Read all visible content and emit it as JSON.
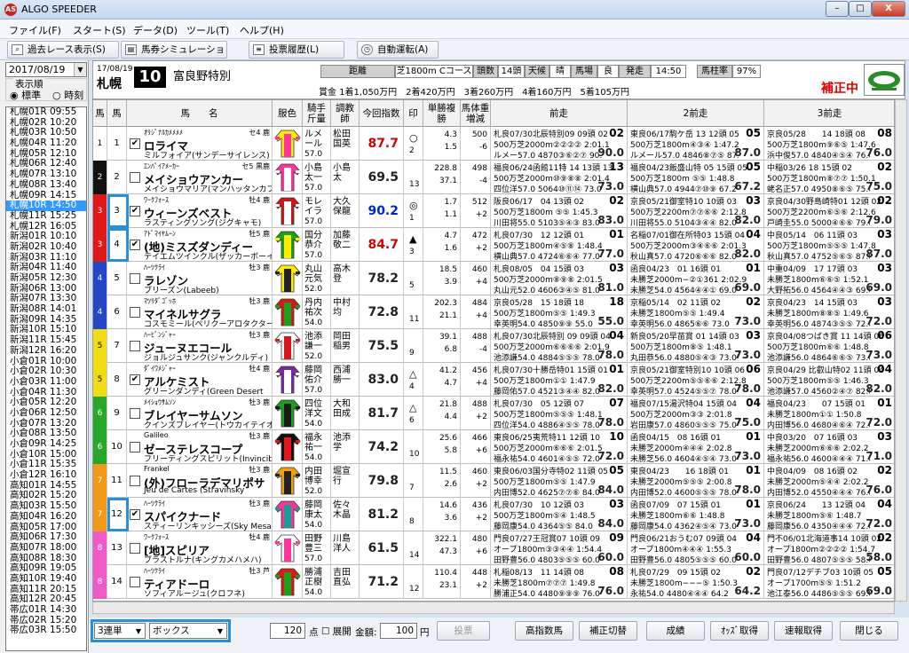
{
  "window": {
    "title": "ALGO SPEEDER",
    "app_icon": "AS",
    "min": "–",
    "max": "□",
    "close": "X"
  },
  "menu": [
    "ファイル(F)",
    "スタート(S)",
    "データ(D)",
    "ツール(T)",
    "ヘルプ(H)"
  ],
  "toolbar": {
    "past": "過去レース表示(S)",
    "sim": "馬券シミュレーション(B)",
    "history": "投票履歴(L)",
    "auto": "自動運転(A)"
  },
  "left": {
    "date": "2017/08/19",
    "group_label": "表示順",
    "radio_std": "標準",
    "radio_time": "時刻",
    "races": [
      "札幌01R 09:55",
      "札幌02R 10:20",
      "札幌03R 10:50",
      "札幌04R 11:20",
      "札幌05R 12:10",
      "札幌06R 12:40",
      "札幌07R 13:10",
      "札幌08R 13:40",
      "札幌09R 14:15",
      "札幌10R 14:50",
      "札幌11R 15:25",
      "札幌12R 16:05",
      "新潟01R 10:10",
      "新潟02R 10:40",
      "新潟03R 11:10",
      "新潟04R 11:40",
      "新潟05R 12:30",
      "新潟06R 13:00",
      "新潟07R 13:30",
      "新潟08R 14:01",
      "新潟09R 14:35",
      "新潟10R 15:10",
      "新潟11R 15:45",
      "新潟12R 16:20",
      "小倉01R 10:00",
      "小倉02R 10:30",
      "小倉03R 11:00",
      "小倉04R 11:30",
      "小倉05R 12:20",
      "小倉06R 12:50",
      "小倉07R 13:20",
      "小倉08R 13:50",
      "小倉09R 14:25",
      "小倉10R 15:00",
      "小倉11R 15:35",
      "小倉12R 16:10",
      "高知01R 14:55",
      "高知02R 15:20",
      "高知03R 15:50",
      "高知04R 16:20",
      "高知05R 17:00",
      "高知06R 17:30",
      "高知07R 18:00",
      "高知08R 18:30",
      "高知09R 19:05",
      "高知10R 19:40",
      "高知11R 20:15",
      "高知12R 20:45",
      "帯広01R 14:30",
      "帯広02R 15:20",
      "帯広03R 15:50"
    ],
    "selected_index": 9
  },
  "header": {
    "date": "17/08/19",
    "place": "札幌",
    "race_no": "10",
    "race_name": "富良野特別",
    "dist_label": "距離",
    "dist": "芝1800m Cコース",
    "heads_label": "頭数",
    "heads": "14頭",
    "weather_label": "天候",
    "weather": "晴",
    "baba_label": "馬場",
    "baba": "良",
    "start_label": "発走",
    "start": "14:50",
    "rate_label": "馬柱率",
    "rate": "97%",
    "prize": "賞金 1着1,050万円　2着420万円　3着260万円　4着160万円　5着105万円",
    "status": "補正中"
  },
  "columns": [
    "馬",
    "馬",
    "馬　　名",
    "服色",
    "騎手斤量",
    "調教師",
    "今回指数",
    "印",
    "単勝複勝",
    "馬体重増減",
    "前走",
    "2前走",
    "3前走"
  ],
  "horses": [
    {
      "waku": "1",
      "no": "1",
      "checked": true,
      "sire": "ｵﾘｼﾞﾅﾙｶﾒﾒﾒﾒ",
      "sexage": "セ4 鹿",
      "name": "ロライマ",
      "dam": "ミルフォイア(サンデーサイレンス)",
      "jockey": "ルメール",
      "weight": "57.0",
      "trainer": "松田国英",
      "score": "87.7",
      "mark": "○",
      "mark2": "2",
      "win": "4.3",
      "place": "1.5",
      "bw": "500",
      "bwd": "-6",
      "p1a": "札良07/30北辰特別09 09頭 02",
      "p1b": "500万芝2000m②②②② 2:01.1",
      "p1c": "ルメー57.0 4870③⑥②⑦ 90.0",
      "p1r": "02",
      "p1i": "90.0",
      "p2a": "東良06/17駒ケ岳 13 12頭 05",
      "p2b": "500万芝1800m④③④ 1:47.2",
      "p2c": "ルメール57.0 4846⑧⑦⑤ 87.0",
      "p2r": "05",
      "p2i": "87.0",
      "p3a": "京良05/28　　14 18頭 08",
      "p3b": "500万芝1800m⑨⑥⑤ 1:47.6",
      "p3c": "浜中俊57.0 4840④⑤④ 76.0",
      "p3r": "08",
      "p3i": "76.0"
    },
    {
      "waku": "2",
      "no": "2",
      "checked": false,
      "sire": "ｴﾝﾊﾟｲｱﾒｰｶｰ",
      "sexage": "セ5 黒鹿",
      "name": "メイショウアンカー",
      "dam": "メイショウマリア(マンハッタンカフェ)",
      "jockey": "小島太一",
      "weight": "57.0",
      "trainer": "小島太",
      "score": "69.5",
      "mark": "",
      "mark2": "13",
      "win": "228.8",
      "place": "37.1",
      "bw": "498",
      "bwd": "-4",
      "p1a": "福良06/24函館11特 14 13頭 13",
      "p1b": "500万芝2000m⑩⑨⑧⑧ 2:01.4",
      "p1c": "四位洋57.0 5064⑩⑪⑭ 73.0",
      "p1r": "13",
      "p1i": "73.0",
      "p2a": "福良04/23飯盛山特 05 15頭 05",
      "p2b": "500万芝1800m ⑤⑤ 1:48.8",
      "p2c": "横山典57.0 4944⑦⑩⑨ 67.2",
      "p2r": "05",
      "p2i": "67.2",
      "p3a": "中稲03/26 18 15頭 02",
      "p3b": "500万芝1800m⑧⑦⑦ 1:50.1",
      "p3c": "蛯名正57.0 4950⑧⑥⑤ 75.0",
      "p3r": "02",
      "p3i": "75.0"
    },
    {
      "waku": "3",
      "no": "3",
      "checked": true,
      "sire": "ﾜｰｸﾌｫｰｽ",
      "sexage": "牡4 鹿",
      "name": "ウィーンズベスト",
      "dam": "ラスティングソング(ジグキャモ)",
      "jockey": "モレイラ",
      "weight": "57.0",
      "trainer": "大久保龍",
      "score": "90.2",
      "mark": "◎",
      "mark2": "1",
      "win": "1.7",
      "place": "1.1",
      "bw": "512",
      "bwd": "+2",
      "p1a": "阪良06/17　04 13頭 02",
      "p1b": "500万芝1800m ⑤⑤ 1:45.3",
      "p1c": "川田将55.0 5103⑤④③ 83.0",
      "p1r": "02",
      "p1i": "83.0",
      "p2a": "京良05/21御室特10 10頭 03",
      "p2b": "500万芝2200m⑦⑦⑥⑥ 2:12.8",
      "p2c": "川田将55.0 5104③④④ 82.0",
      "p2r": "03",
      "p2i": "82.0",
      "p3a": "京良04/30野島崎特01 12頭 02",
      "p3b": "500万芝2200m⑥⑤⑥ 2:12.6",
      "p3c": "戸崎圭55.0 5000④⑥⑥ 79.0",
      "p3r": "02",
      "p3i": "79.0"
    },
    {
      "waku": "3",
      "no": "4",
      "checked": true,
      "sire": "ｱﾄﾞﾏｲﾔﾑｰﾝ",
      "sexage": "牡5 鹿",
      "name": "(地)ミスズダンディー",
      "dam": "テイエムツインクル(ザッカーボーイ)",
      "jockey": "国分恭介",
      "weight": "57.0",
      "trainer": "加藤敬二",
      "score": "84.7",
      "mark": "▲",
      "mark2": "3",
      "win": "4.7",
      "place": "1.6",
      "bw": "472",
      "bwd": "+2",
      "p1a": "札良07/30　12 12頭 01",
      "p1b": "500万芝1800m④⑤⑧ 1:48.4",
      "p1c": "横山典57.0 4724⑥⑥④ 77.0",
      "p1r": "01",
      "p1i": "77.0",
      "p2a": "名稲07/01御在所特03 15頭 04",
      "p2b": "500万芝2000m③④⑥⑥ 2:01.3",
      "p2c": "秋山真57.0 4720⑥⑥⑥ 82.0",
      "p2r": "04",
      "p2i": "82.0",
      "p3a": "中良05/14　06 11頭 03",
      "p3b": "500万芝1800m⑤⑤⑤ 1:47.8",
      "p3c": "秋山真57.0 4752⑤⑥⑤ 87.0",
      "p3r": "03",
      "p3i": "87.0"
    },
    {
      "waku": "4",
      "no": "5",
      "checked": false,
      "sire": "ﾊｰﾂｸﾗｲ",
      "sexage": "牡3 鹿",
      "name": "ラレゾン",
      "dam": "ブリーズン(Labeeb)",
      "jockey": "丸山元気",
      "weight": "52.0",
      "trainer": "高木登",
      "score": "78.2",
      "mark": "",
      "mark2": "5",
      "win": "18.5",
      "place": "3.9",
      "bw": "460",
      "bwd": "+4",
      "p1a": "札良08/05　04 15頭 03",
      "p1b": "500万芝2000m⑧⑨⑧ 2:01.5",
      "p1c": "丸山元52.0 4606③④⑤ 81.0",
      "p1r": "03",
      "p1i": "81.0",
      "p2a": "函良04/23　01 16頭 01",
      "p2b": "未勝芝2000m−②①361 2:02.9",
      "p2c": "未勝芝54.0 4564④④① 69.0",
      "p2r": "01",
      "p2i": "69.0",
      "p3a": "中重04/09　17 17頭 03",
      "p3b": "未勝芝1800m⑥⑥⑤ 1:52.1",
      "p3c": "大野拓56.0 4564④④③ 69.0",
      "p3r": "03",
      "p3i": "69.0"
    },
    {
      "waku": "4",
      "no": "6",
      "checked": false,
      "sire": "ﾏﾂﾘﾀﾞｺﾞｯﾎ",
      "sexage": "牡3 鹿",
      "name": "マイネルサグラ",
      "dam": "コスモミール(ペリクーアロタクター)",
      "jockey": "丹内祐次",
      "weight": "54.0",
      "trainer": "中村均",
      "score": "72.8",
      "mark": "",
      "mark2": "11",
      "win": "202.3",
      "place": "21.1",
      "bw": "484",
      "bwd": "+4",
      "p1a": "京良05/28　15 18頭 18",
      "p1b": "500万芝1800m⑤⑤ 1:49.3",
      "p1c": "幸英明54.0 4850⑨⑨ 55.0",
      "p1r": "18",
      "p1i": "55.0",
      "p2a": "京稲05/14　02 11頭 02",
      "p2b": "未勝芝1800m⑤⑤ 1:49.4",
      "p2c": "幸英明56.0 4865⑥⑥ 73.0",
      "p2r": "02",
      "p2i": "73.0",
      "p3a": "京良04/23　14 15頭 03",
      "p3b": "未勝芝1800m⑧⑧⑤ 1:49.6",
      "p3c": "幸英明56.0 4874③⑤⑤ 72.0",
      "p3r": "03",
      "p3i": "72.0"
    },
    {
      "waku": "5",
      "no": "7",
      "checked": false,
      "sire": "ﾊｰﾋﾞﾝｼﾞｬｰ",
      "sexage": "牡3 鹿",
      "name": "ジューヌエコール",
      "dam": "ジョルジュサンク(ジャンクルディ)",
      "jockey": "池添謙一",
      "weight": "52.0",
      "trainer": "岡田稲男",
      "score": "75.5",
      "mark": "",
      "mark2": "9",
      "win": "39.1",
      "place": "6.8",
      "bw": "488",
      "bwd": "-4",
      "p1a": "札良07/30北辰特別 09 09頭 04",
      "p1b": "500万芝2000m⑥⑥⑥⑥ 2:01.9",
      "p1c": "池添謙54.0 4884⑤⑤⑤ 78.0",
      "p1r": "04",
      "p1i": "78.0",
      "p2a": "新良05/20早苗賞 01 14頭 03",
      "p2b": "500万芝1800m⑧⑤ 1:48.1",
      "p2c": "丸田恭56.0 4880⑤④③ 73.0",
      "p2r": "03",
      "p2i": "73.0",
      "p3a": "京良04/08つばき賞 11 14頭 06",
      "p3b": "500万芝1800m⑥⑥ 1:48.8",
      "p3c": "池添謙56.0 4864⑥⑥⑤ 73.0",
      "p3r": "06",
      "p3i": "73.0"
    },
    {
      "waku": "5",
      "no": "8",
      "checked": true,
      "sire": "ﾀﾞｲﾜﾒｼﾞｬｰ",
      "sexage": "牡4 鹿",
      "name": "アルケミスト",
      "dam": "グリーンダンディ(Green Desert",
      "jockey": "藤岡佑介",
      "weight": "57.0",
      "trainer": "西浦勝一",
      "score": "83.0",
      "mark": "△",
      "mark2": "4",
      "win": "41.2",
      "place": "4.7",
      "bw": "456",
      "bwd": "+4",
      "p1a": "札良07/30十勝岳特01 15頭 01",
      "p1b": "500万芝1800m①① 1:47.9",
      "p1c": "藤岡佑57.0 4521③④④ 82.0",
      "p1r": "01",
      "p1i": "82.0",
      "p2a": "京良05/21御室特別10 10頭 06",
      "p2b": "500万芝2200m⑤⑤⑥⑥ 2:12.8",
      "p2c": "幸英明57.0 4524⑤⑤⑦ 78.0",
      "p2r": "06",
      "p2i": "78.0",
      "p3a": "京良04/29 比叡山特02 11頭 04",
      "p3b": "500万芝1800m⑤⑤ 1:46.3",
      "p3c": "池添謙57.0 4560②④⑦ 82.0",
      "p3r": "04",
      "p3i": "82.0"
    },
    {
      "waku": "6",
      "no": "9",
      "checked": false,
      "sire": "ﾒｲｼｮｳｻﾑｿﾝ",
      "sexage": "牡3 鹿",
      "name": "ブレイヤーサムソン",
      "dam": "クインズブレイヤー(トウカイテイオー)",
      "jockey": "四位洋文",
      "weight": "54.0",
      "trainer": "大和田成",
      "score": "81.7",
      "mark": "△",
      "mark2": "6",
      "win": "21.8",
      "place": "4.4",
      "bw": "488",
      "bwd": "+2",
      "p1a": "札良07/30　05 12頭 07",
      "p1b": "500万芝1800m⑤⑤⑤ 1:48.1",
      "p1c": "四位洋54.0 4886④⑤⑤ 78.0",
      "p1r": "07",
      "p1i": "78.0",
      "p2a": "福良07/15湯沢特04 15頭 04",
      "p2b": "500万芝2000m③③ 2:01.8",
      "p2c": "岩田康57.0 4860⑤⑤⑤ 75.0",
      "p2r": "04",
      "p2i": "75.0",
      "p3a": "福良04/23　　07 15頭 01",
      "p3b": "未勝芝1800m①① 1:50.8",
      "p3c": "内田博56.0 4680④⑥④ 72.0",
      "p3r": "01",
      "p3i": "72.0"
    },
    {
      "waku": "6",
      "no": "10",
      "checked": false,
      "sire": "Galileo",
      "sexage": "牡3 鹿",
      "name": "ゼーステレスコープ",
      "dam": "フリーティングスピリット(Invincibl",
      "jockey": "福永祐一",
      "weight": "54.0",
      "trainer": "池添学",
      "score": "74.2",
      "mark": "",
      "mark2": "10",
      "win": "25.6",
      "place": "5.8",
      "bw": "466",
      "bwd": "+6",
      "p1a": "東良06/25夷荒特11 12頭 10",
      "p1b": "500万芝2000m⑥⑥⑥ 2:01.5",
      "p1c": "福永祐54.0 4601④⑤⑤ 72.0",
      "p1r": "10",
      "p1i": "72.0",
      "p2a": "函良04/15　08 16頭 01",
      "p2b": "未勝芝2000m④④④ 2:02.8",
      "p2c": "未勝芝56.0 4604④⑤④ 73.0",
      "p2r": "01",
      "p2i": "73.0",
      "p3a": "中良03/20　07 16頭 03",
      "p3b": "未勝芝2000m⑥⑥⑥ 2:02.2",
      "p3c": "福永祐56.0 4600④④④ 71.0",
      "p3r": "03",
      "p3i": "71.0"
    },
    {
      "waku": "7",
      "no": "11",
      "checked": false,
      "sire": "Frankel",
      "sexage": "牡3 鹿",
      "name": "(外)フローラデマリポサ",
      "dam": "Jeu de Cartes (Stravinsky",
      "jockey": "内田博幸",
      "weight": "52.0",
      "trainer": "堀宣行",
      "score": "79.8",
      "mark": "",
      "mark2": "7",
      "win": "11.5",
      "place": "2.6",
      "bw": "460",
      "bwd": "+2",
      "p1a": "東良06/03国分寺特02 11頭 05",
      "p1b": "500万芝1800m⑤⑤ 1:47.9",
      "p1c": "内田博52.0 4625⑦⑦⑥ 84.0",
      "p1r": "05",
      "p1i": "84.0",
      "p2a": "東良04/23　　16 18頭 01",
      "p2b": "未勝芝2000m⑤⑤⑤ 2:00.8",
      "p2c": "内田博52.0 4600⑤⑤⑤ 78.0",
      "p2r": "01",
      "p2i": "78.0",
      "p3a": "中良04/09　08 16頭 02",
      "p3b": "未勝芝2000m⑤④④ 2:02.2",
      "p3c": "内田博52.0 4550④④④ 76.0",
      "p3r": "02",
      "p3i": "76.0"
    },
    {
      "waku": "7",
      "no": "12",
      "checked": true,
      "sire": "ﾊｰﾂｸﾗｲ",
      "sexage": "牡3 鹿",
      "name": "スパイクナード",
      "dam": "スティーリンキッシーズ(Sky Mesa)",
      "jockey": "藤岡康太",
      "weight": "54.0",
      "trainer": "佐々木晶",
      "score": "81.2",
      "mark": "",
      "mark2": "8",
      "win": "14.6",
      "place": "3.6",
      "bw": "436",
      "bwd": "+2",
      "p1a": "札良07/30　10 12頭 03",
      "p1b": "500万芝1800m⑤④ 1:48.5",
      "p1c": "藤岡康54.0 4364⑤⑤ 84.0",
      "p1r": "03",
      "p1i": "84.0",
      "p2a": "函良07/09　07 15頭 01",
      "p2b": "未勝芝1800m⑥⑥ 1:48.8",
      "p2c": "藤岡康54.0 4362④⑤④ 73.0",
      "p2r": "01",
      "p2i": "73.0",
      "p3a": "京良06/24　　13 12頭 04",
      "p3b": "未勝芝1800m⑤⑥ 1:48.7",
      "p3c": "藤岡康56.0 4350④④④ 72.0",
      "p3r": "04",
      "p3i": "72.0"
    },
    {
      "waku": "8",
      "no": "13",
      "checked": false,
      "sire": "ﾜｰｸﾌｫｰｽ",
      "sexage": "牡4 鹿",
      "name": "[地]スピリア",
      "dam": "ブラストルナ(キングカメハメハ)",
      "jockey": "田野豊三",
      "weight": "57.0",
      "trainer": "川島洋人",
      "score": "61.5",
      "mark": "",
      "mark2": "14",
      "win": "322.1",
      "place": "47.3",
      "bw": "480",
      "bwd": "+6",
      "p1a": "門良07/27王冠賞07 10頭 09",
      "p1b": "オープ1800m③③④④ 1:54.4",
      "p1c": "田野豊56.0 4803⑤⑤⑤ 60.0",
      "p1r": "09",
      "p1i": "60.0",
      "p2a": "門良06/21おうむ07 09頭 04",
      "p2b": "オープ1800m④④④ 1:55.3",
      "p2c": "田野豊56.0 4805⑤⑤⑤ 60.0",
      "p2r": "04",
      "p2i": "60.0",
      "p3a": "門不06/01北海道事14 10頭 02",
      "p3b": "オープ1800m②②②② 1:54.7",
      "p3c": "田野豊56.0 4807⑤⑤⑤ 58.0",
      "p3r": "02",
      "p3i": "58.0"
    },
    {
      "waku": "8",
      "no": "14",
      "checked": false,
      "sire": "ﾊｰﾂｸﾗｲ",
      "sexage": "牡3 芦",
      "name": "ティアドーロ",
      "dam": "ソフィアルージュ(クロフネ)",
      "jockey": "勝浦正樹",
      "weight": "54.0",
      "trainer": "吉田直弘",
      "score": "71.2",
      "mark": "",
      "mark2": "12",
      "win": "110.4",
      "place": "23.1",
      "bw": "448",
      "bwd": "+2",
      "p1a": "札稲08/13　11 14頭 08",
      "p1b": "未勝芝1800m⑦⑦⑦ 1:49.8",
      "p1c": "勝浦正54.0 4480⑨⑨⑨ 76.0",
      "p1r": "08",
      "p1i": "76.0",
      "p2a": "札良07/29　09 15頭 02",
      "p2b": "未勝芝1800m−−−⑤ 1:50.3",
      "p2c": "永祐54.0 4480④④④ 64.2",
      "p2r": "02",
      "p2i": "64.2",
      "p3a": "門良07/12デチブ03 10頭 05",
      "p3b": "オープ1700m⑤⑤ 1:51.2",
      "p3c": "池江泰56.0 4486⑤⑤⑤ 69.0",
      "p3r": "05",
      "p3i": "69.0"
    }
  ],
  "bottom": {
    "bet_type": "3連単",
    "bet_method": "ボックス",
    "points": "120",
    "points_unit": "点",
    "tenkai": "展開",
    "amount_label": "金額:",
    "amount": "100",
    "amount_unit": "円",
    "vote": "投票",
    "b1": "高指数馬",
    "b2": "補正切替",
    "b3": "成績",
    "b4": "ｵｯｽﾞ取得",
    "b5": "速報取得",
    "b6": "閉じる"
  },
  "colors": {
    "waku1": "#ffffff",
    "waku2": "#111111",
    "waku3": "#e01818",
    "waku4": "#2646c8",
    "waku5": "#f0dc10",
    "waku6": "#28a828",
    "waku7": "#f29a18",
    "waku8": "#f05ac8",
    "score_red": "#d00000",
    "score_blue": "#0028c8",
    "highlight": "#2a8fd8"
  }
}
